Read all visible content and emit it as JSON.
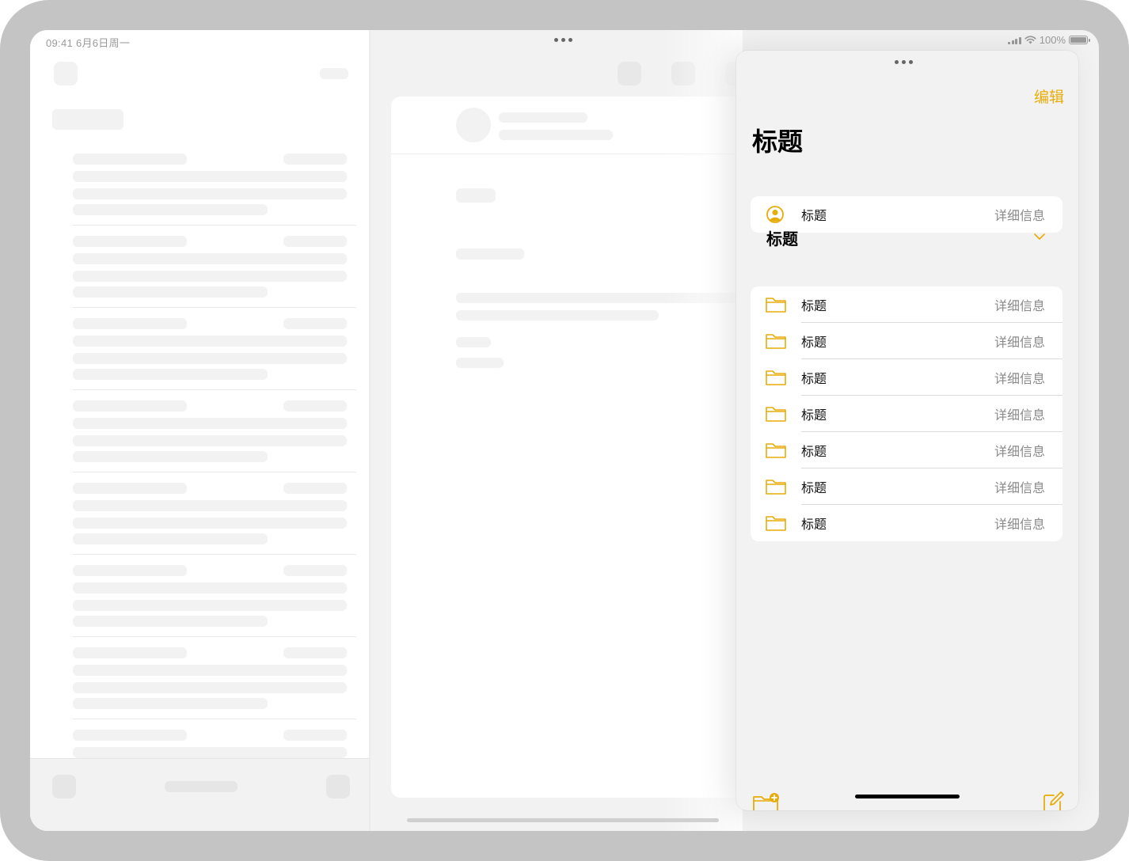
{
  "status_bar": {
    "time_date": "09:41  6月6日周一",
    "battery": "100%"
  },
  "slide_over": {
    "edit_label": "编辑",
    "large_title": "标题",
    "account_row": {
      "title": "标题",
      "detail": "详细信息",
      "icon": "person-circle-icon"
    },
    "section": {
      "title": "标题",
      "rows": [
        {
          "title": "标题",
          "detail": "详细信息",
          "icon": "folder-icon"
        },
        {
          "title": "标题",
          "detail": "详细信息",
          "icon": "folder-icon"
        },
        {
          "title": "标题",
          "detail": "详细信息",
          "icon": "folder-icon"
        },
        {
          "title": "标题",
          "detail": "详细信息",
          "icon": "folder-icon"
        },
        {
          "title": "标题",
          "detail": "详细信息",
          "icon": "folder-icon"
        },
        {
          "title": "标题",
          "detail": "详细信息",
          "icon": "folder-icon"
        },
        {
          "title": "标题",
          "detail": "详细信息",
          "icon": "folder-icon"
        }
      ]
    },
    "toolbar": {
      "new_folder_icon": "folder-badge-plus-icon",
      "compose_icon": "square-and-pencil-icon"
    }
  },
  "colors": {
    "accent": "#e8ac0a",
    "background": "#f2f2f2",
    "placeholder": "#f2f2f2",
    "device_frame": "#c4c4c4"
  }
}
